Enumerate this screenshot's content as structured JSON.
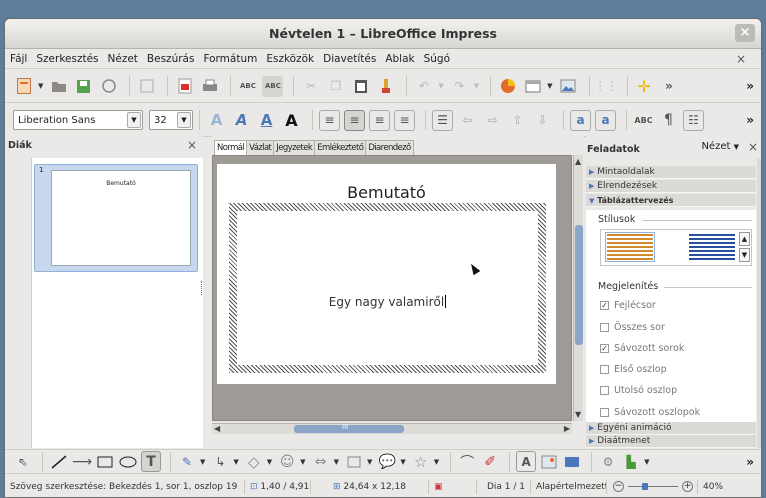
{
  "window": {
    "title": "Névtelen 1 – LibreOffice Impress",
    "close": "×"
  },
  "menu": {
    "items": [
      "Fájl",
      "Szerkesztés",
      "Nézet",
      "Beszúrás",
      "Formátum",
      "Eszközök",
      "Diavetítés",
      "Ablak",
      "Súgó"
    ],
    "close": "×"
  },
  "format_toolbar": {
    "font_name": "Liberation Sans",
    "font_size": "32",
    "more": "»"
  },
  "standard_toolbar": {
    "more": "»"
  },
  "slides_panel": {
    "title": "Diák",
    "close": "×",
    "slides": [
      {
        "number": "1",
        "title": "Bemutató"
      }
    ]
  },
  "editor": {
    "tabs": [
      "Normál",
      "Vázlat",
      "Jegyzetek",
      "Emlékeztető",
      "Diarendező"
    ],
    "active_tab": "Normál",
    "slide_title": "Bemutató",
    "slide_body": "Egy nagy valamiről",
    "hscroll_label": "III"
  },
  "task_panel": {
    "title": "Feladatok",
    "view_label": "Nézet",
    "close": "×",
    "sections": [
      "Mintaoldalak",
      "Elrendezések",
      "Táblázattervezés"
    ],
    "styles_label": "Stílusok",
    "display_label": "Megjelenítés",
    "options": [
      {
        "label": "Fejlécsor",
        "checked": true
      },
      {
        "label": "Összes sor",
        "checked": false
      },
      {
        "label": "Sávozott sorok",
        "checked": true
      },
      {
        "label": "Első oszlop",
        "checked": false
      },
      {
        "label": "Utolsó oszlop",
        "checked": false
      },
      {
        "label": "Sávozott oszlopok",
        "checked": false
      }
    ],
    "bottom_sections": [
      "Egyéni animáció",
      "Diaátmenet"
    ]
  },
  "drawing_toolbar": {
    "more": "»"
  },
  "status": {
    "mode": "Szöveg szerkesztése: Bekezdés 1, sor 1, oszlop 19",
    "position": "1,40 / 4,91",
    "size": "24,64 x 12,18",
    "slide": "Dia 1 / 1",
    "layout": "Alapértelmezett",
    "zoom": "40%",
    "zoom_minus": "−",
    "zoom_plus": "+"
  }
}
